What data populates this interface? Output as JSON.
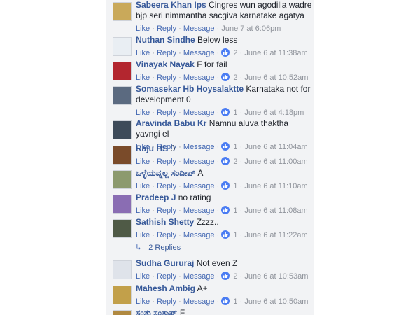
{
  "actions": {
    "like": "Like",
    "reply": "Reply",
    "message": "Message",
    "sep": "·"
  },
  "comments": [
    {
      "author": "Sabeera Khan Ips",
      "text": "Cingres wun agodilla wadre bjp seri nimmantha sacgiva karnatake agatya",
      "likes": "",
      "time": "June 7 at 6:06pm",
      "avatar_color": "#c9a95a",
      "avatar_icon": "group-photo-avatar"
    },
    {
      "author": "Nuthan Sindhe",
      "text": "Below less",
      "likes": "2",
      "time": "June 6 at 11:38am",
      "avatar_color": "#e9eef3",
      "avatar_icon": "person-avatar"
    },
    {
      "author": "Vinayak Nayak",
      "text": "F for fail",
      "likes": "2",
      "time": "June 6 at 10:52am",
      "avatar_color": "#b3262f",
      "avatar_icon": "car-avatar"
    },
    {
      "author": "Somasekar Hb Hoysalaktte",
      "text": "Karnataka not for development 0",
      "likes": "1",
      "time": "June 6 at 4:18pm",
      "avatar_color": "#5b6a80",
      "avatar_icon": "car-avatar"
    },
    {
      "author": "Aravinda Babu Kr",
      "text": "Namnu aluva thaktha yavngi el",
      "likes": "1",
      "time": "June 6 at 11:04am",
      "avatar_color": "#3e4b5a",
      "avatar_icon": "bike-avatar"
    },
    {
      "author": "Raju HS",
      "text": "0",
      "likes": "2",
      "time": "June 6 at 11:00am",
      "avatar_color": "#7a4b2a",
      "avatar_icon": "person-avatar"
    },
    {
      "author": "ಒಳ್ಳೆಯವ್ನಲ್ಲ ಸಂದೀಪ್",
      "text": "A",
      "likes": "1",
      "time": "June 6 at 11:10am",
      "avatar_color": "#8c9a6e",
      "avatar_icon": "person-avatar"
    },
    {
      "author": "Pradeep J",
      "text": "no rating",
      "likes": "1",
      "time": "June 6 at 11:08am",
      "avatar_color": "#8a6db3",
      "avatar_icon": "group-photo-avatar"
    },
    {
      "author": "Sathish Shetty",
      "text": "Zzzz..",
      "likes": "1",
      "time": "June 6 at 11:22am",
      "avatar_color": "#4f5a46",
      "avatar_icon": "person-avatar"
    },
    {
      "author": "Sudha Gururaj",
      "text": "Not even Z",
      "likes": "2",
      "time": "June 6 at 10:53am",
      "avatar_color": "#dfe3ea",
      "avatar_icon": "default-avatar"
    },
    {
      "author": "Mahesh Ambig",
      "text": "A+",
      "likes": "1",
      "time": "June 6 at 10:50am",
      "avatar_color": "#c2a04a",
      "avatar_icon": "person-avatar"
    },
    {
      "author": "ಸಂತು ಸಂತಾಷ್",
      "text": "F",
      "likes": "",
      "time": "",
      "avatar_color": "#b08940",
      "avatar_icon": "person-avatar"
    }
  ],
  "replies_link": "2 Replies",
  "colors": {
    "panel_bg": "#f2f3f5",
    "author": "#365899",
    "link": "#4267b2",
    "muted": "#90949c",
    "like_badge": "#4a7cf3"
  }
}
